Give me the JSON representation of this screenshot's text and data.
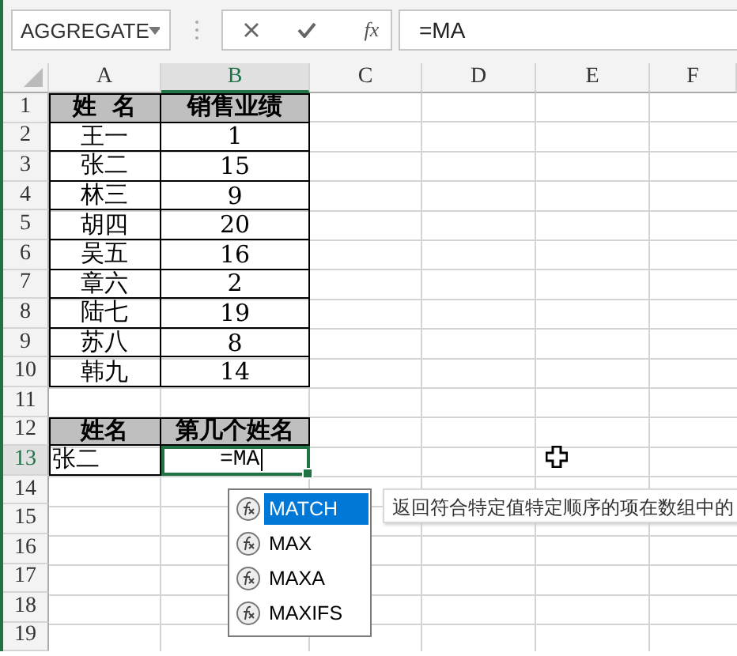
{
  "toolbar": {
    "name_box": "AGGREGATE",
    "insert_function": "fx",
    "formula": "=MA"
  },
  "columns": [
    {
      "label": "A",
      "selected": false
    },
    {
      "label": "B",
      "selected": true
    },
    {
      "label": "C",
      "selected": false
    },
    {
      "label": "D",
      "selected": false
    },
    {
      "label": "E",
      "selected": false
    },
    {
      "label": "F",
      "selected": false
    }
  ],
  "rows": [
    {
      "number": "1",
      "selected": false,
      "cells": [
        {
          "text": "姓  名",
          "kind": "header"
        },
        {
          "text": "销售业绩",
          "kind": "header"
        }
      ]
    },
    {
      "number": "2",
      "selected": false,
      "cells": [
        {
          "text": "王一",
          "kind": "data"
        },
        {
          "text": "1",
          "kind": "data"
        }
      ]
    },
    {
      "number": "3",
      "selected": false,
      "cells": [
        {
          "text": "张二",
          "kind": "data"
        },
        {
          "text": "15",
          "kind": "data"
        }
      ]
    },
    {
      "number": "4",
      "selected": false,
      "cells": [
        {
          "text": "林三",
          "kind": "data"
        },
        {
          "text": "9",
          "kind": "data"
        }
      ]
    },
    {
      "number": "5",
      "selected": false,
      "cells": [
        {
          "text": "胡四",
          "kind": "data"
        },
        {
          "text": "20",
          "kind": "data"
        }
      ]
    },
    {
      "number": "6",
      "selected": false,
      "cells": [
        {
          "text": "吴五",
          "kind": "data"
        },
        {
          "text": "16",
          "kind": "data"
        }
      ]
    },
    {
      "number": "7",
      "selected": false,
      "cells": [
        {
          "text": "章六",
          "kind": "data"
        },
        {
          "text": "2",
          "kind": "data"
        }
      ]
    },
    {
      "number": "8",
      "selected": false,
      "cells": [
        {
          "text": "陆七",
          "kind": "data"
        },
        {
          "text": "19",
          "kind": "data"
        }
      ]
    },
    {
      "number": "9",
      "selected": false,
      "cells": [
        {
          "text": "苏八",
          "kind": "data"
        },
        {
          "text": "8",
          "kind": "data"
        }
      ]
    },
    {
      "number": "10",
      "selected": false,
      "cells": [
        {
          "text": "韩九",
          "kind": "data"
        },
        {
          "text": "14",
          "kind": "data"
        }
      ]
    },
    {
      "number": "11",
      "selected": false
    },
    {
      "number": "12",
      "selected": false,
      "cells": [
        {
          "text": "姓名",
          "kind": "header"
        },
        {
          "text": "第几个姓名",
          "kind": "header"
        }
      ]
    },
    {
      "number": "13",
      "selected": true,
      "cells": [
        {
          "text": "张二",
          "kind": "left"
        },
        {
          "text": "=MA",
          "kind": "editing"
        }
      ]
    },
    {
      "number": "14",
      "selected": false
    },
    {
      "number": "15",
      "selected": false
    },
    {
      "number": "16",
      "selected": false
    },
    {
      "number": "17",
      "selected": false
    },
    {
      "number": "18",
      "selected": false
    },
    {
      "number": "19",
      "selected": false
    }
  ],
  "autocomplete": {
    "items": [
      {
        "label": "MATCH",
        "selected": true
      },
      {
        "label": "MAX",
        "selected": false
      },
      {
        "label": "MAXA",
        "selected": false
      },
      {
        "label": "MAXIFS",
        "selected": false
      }
    ],
    "tooltip": "返回符合特定值特定顺序的项在数组中的"
  }
}
